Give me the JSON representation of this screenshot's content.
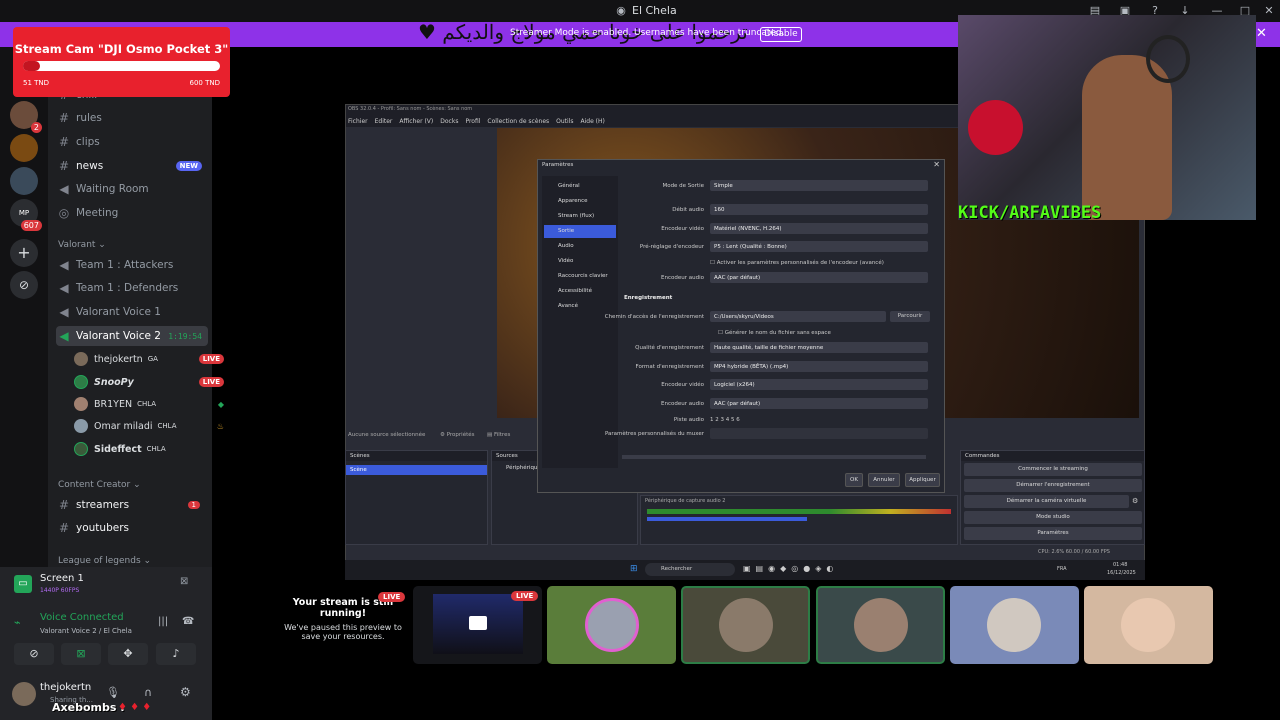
{
  "window": {
    "title": "El Chela"
  },
  "banner": {
    "text": "Streamer Mode is enabled. Usernames have been truncated.",
    "disable": "Disable",
    "overlay_text": "♥ ترحموا على خونا حمي مولاج والديكم"
  },
  "goal": {
    "title": "Stream Cam \"DJI Osmo Pocket 3\"",
    "min": "51 TND",
    "max": "600 TND",
    "progress": 0.085
  },
  "rail": {
    "badges": [
      "2",
      "607"
    ],
    "mp_label": "MP"
  },
  "channels": {
    "top_partial": "chill",
    "text": [
      {
        "name": "rules"
      },
      {
        "name": "clips"
      },
      {
        "name": "news",
        "badge": "NEW"
      }
    ],
    "voice_top": [
      {
        "name": "Waiting Room"
      },
      {
        "name": "Meeting"
      }
    ],
    "cat_valorant": "Valorant",
    "valorant": [
      {
        "name": "Team 1 : Attackers"
      },
      {
        "name": "Team 1 : Defenders"
      },
      {
        "name": "Valorant Voice 1"
      }
    ],
    "active_voice": {
      "name": "Valorant Voice 2",
      "timer": "1:19:54"
    },
    "users": [
      {
        "name": "thejokertn",
        "tag": "GA",
        "live": "LIVE"
      },
      {
        "name": "SnooPy",
        "live": "LIVE"
      },
      {
        "name": "BR1YEN",
        "tag": "CHLA"
      },
      {
        "name": "Omar miladi",
        "tag": "CHLA"
      },
      {
        "name": "Sideffect",
        "tag": "CHLA"
      }
    ],
    "cat_content": "Content Creator",
    "content": [
      {
        "name": "streamers",
        "badge": "1"
      },
      {
        "name": "youtubers"
      }
    ],
    "cat_lol": "League of legends"
  },
  "screen_share": {
    "title": "Screen 1",
    "quality": "1440P 60FPS"
  },
  "voice_status": {
    "title": "Voice Connected",
    "sub": "Valorant Voice 2 / El Chela"
  },
  "user_panel": {
    "name": "thejokertn",
    "sub": "Sharing th...",
    "overlay": "Axebombs :"
  },
  "obs": {
    "title": "OBS 32.0.4 - Profil: Sans nom - Scènes: Sans nom",
    "menu": [
      "Fichier",
      "Editer",
      "Afficher (V)",
      "Docks",
      "Profil",
      "Collection de scènes",
      "Outils",
      "Aide (H)"
    ],
    "dialog_title": "Paramètres",
    "nav": [
      "Général",
      "Apparence",
      "Stream (flux)",
      "Sortie",
      "Audio",
      "Vidéo",
      "Raccourcis clavier",
      "Accessibilité",
      "Avancé"
    ],
    "nav_selected": 3,
    "rows": [
      {
        "label": "Mode de Sortie",
        "value": "Simple"
      },
      {
        "label": "Débit audio",
        "value": "160"
      },
      {
        "label": "Encodeur vidéo",
        "value": "Matériel (NVENC, H.264)"
      },
      {
        "label": "Pré-réglage d'encodeur",
        "value": "P5 : Lent (Qualité : Bonne)"
      },
      {
        "label": "",
        "value": "Activer les paramètres personnalisés de l'encodeur (avancé)"
      },
      {
        "label": "Encodeur audio",
        "value": "AAC (par défaut)"
      }
    ],
    "section2": "Enregistrement",
    "rows2": [
      {
        "label": "Chemin d'accès de l'enregistrement",
        "value": "C:/Users/skyru/Videos"
      },
      {
        "label": "",
        "value": "Générer le nom du fichier sans espace"
      },
      {
        "label": "Qualité d'enregistrement",
        "value": "Haute qualité, taille de fichier moyenne"
      },
      {
        "label": "Format d'enregistrement",
        "value": "MP4 hybride (BÊTA) (.mp4)"
      },
      {
        "label": "Encodeur vidéo",
        "value": "Logiciel (x264)"
      },
      {
        "label": "Encodeur audio",
        "value": "AAC (par défaut)"
      },
      {
        "label": "Piste audio",
        "value": "1   2   3   4   5   6"
      },
      {
        "label": "Paramètres personnalisés du muxer",
        "value": ""
      }
    ],
    "browse": "Parcourir",
    "ok": "OK",
    "cancel": "Annuler",
    "apply": "Appliquer",
    "no_source": "Aucune source sélectionnée",
    "props": "Propriétés",
    "filters": "Filtres",
    "scenes_hd": "Scènes",
    "scene_item": "Scène",
    "sources_hd": "Sources",
    "source_item": "Périphérique",
    "commands_hd": "Commandes",
    "commands": [
      "Commencer le streaming",
      "Démarrer l'enregistrement",
      "Démarrer la caméra virtuelle",
      "Mode studio",
      "Paramètres"
    ],
    "audio_label": "Périphérique de capture audio 2",
    "stats": "CPU: 2.6%   60.00 / 60.00 FPS",
    "search": "Rechercher",
    "tray": "FRA",
    "clock": "01:48",
    "date": "16/12/2025"
  },
  "webcam": {
    "kick": "KICK/ARFAVIBES"
  },
  "paused": {
    "title": "Your stream is still running!",
    "sub": "We've paused this preview to save your resources.",
    "live": "LIVE"
  },
  "tiles_live": "LIVE"
}
